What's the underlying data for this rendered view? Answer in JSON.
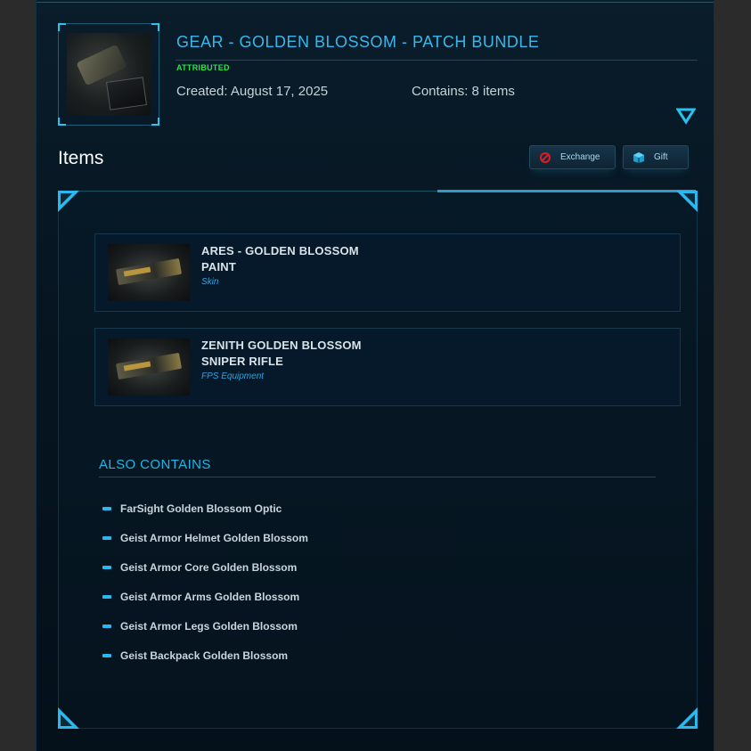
{
  "header": {
    "title": "GEAR - GOLDEN BLOSSOM - PATCH BUNDLE",
    "attributed": "ATTRIBUTED",
    "created": "Created: August 17, 2025",
    "contains": "Contains: 8 items"
  },
  "items_section": {
    "heading": "Items",
    "exchange_label": "Exchange",
    "gift_label": "Gift"
  },
  "items": [
    {
      "name_line1": "ARES - GOLDEN BLOSSOM",
      "name_line2": "PAINT",
      "type": "Skin"
    },
    {
      "name_line1": "ZENITH GOLDEN BLOSSOM",
      "name_line2": "SNIPER RIFLE",
      "type": "FPS Equipment"
    }
  ],
  "also_contains": {
    "heading": "ALSO CONTAINS",
    "entries": [
      "FarSight Golden Blossom Optic",
      "Geist Armor Helmet Golden Blossom",
      "Geist Armor Core Golden Blossom",
      "Geist Armor Arms Golden Blossom",
      "Geist Armor Legs Golden Blossom",
      "Geist Backpack Golden Blossom"
    ]
  },
  "colors": {
    "accent": "#3ab7ea",
    "attributed": "#2fe04a",
    "item_type": "#2fa4df"
  },
  "icons": {
    "expand": "chevron-down-triangle-icon",
    "exchange": "no-entry-icon",
    "gift": "gift-box-icon"
  }
}
